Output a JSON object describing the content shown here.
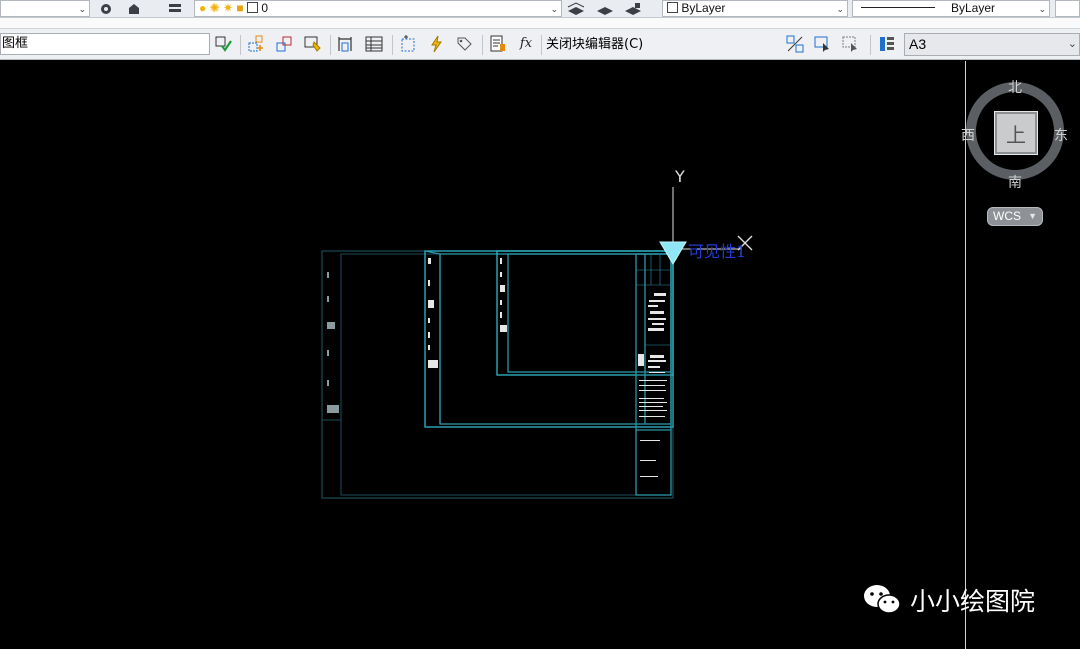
{
  "properties_toolbar": {
    "layer_value": "0",
    "color_value": "ByLayer",
    "linetype_value": "ByLayer"
  },
  "block_editor_toolbar": {
    "block_name": "图框",
    "close_label": "关闭块编辑器(C)",
    "visibility_state": "A3"
  },
  "viewcube": {
    "face": "上",
    "north": "北",
    "south": "南",
    "east": "东",
    "west": "西",
    "coord_system": "WCS"
  },
  "ucs_icon": {
    "y_label": "Y",
    "x_label": "X"
  },
  "attribute_text": "可见性1",
  "watermark": {
    "text": "小小绘图院",
    "icon": "wechat-icon"
  },
  "colors": {
    "drawing_cyan": "#2fb7c9",
    "ucs_triangle": "#8fe7f6",
    "attdef_blue": "#1f3dd6",
    "toolbar_bg": "#eef0f3"
  }
}
